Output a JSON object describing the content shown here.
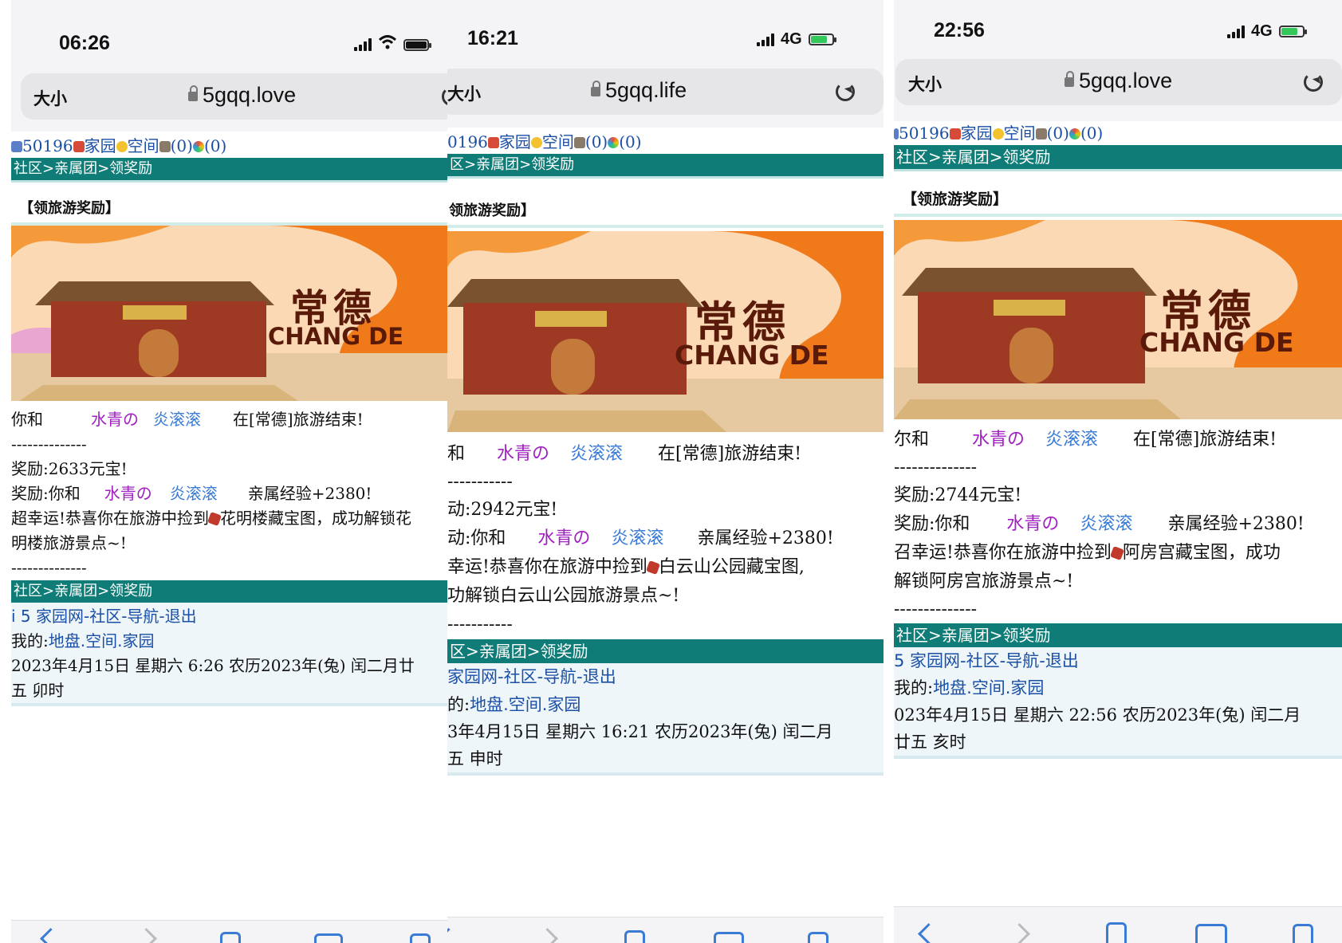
{
  "phones": [
    {
      "status": {
        "time": "06:26",
        "network": ""
      },
      "browser": {
        "text_size_label": "大小",
        "domain": "5gqq.love"
      },
      "top_line": {
        "user_id": "50196",
        "home": "家园",
        "space": "空间",
        "count1": "(0)",
        "count2": "(0)"
      },
      "breadcrumb": "社区>亲属团>领奖励",
      "heading": "【领旅游奖励】",
      "banner": {
        "city_cn": "常德",
        "city_en": "CHANG DE"
      },
      "result": {
        "you_and": "你和",
        "name1": "水青の",
        "name2": "炎滚滚",
        "end_text": "在[常德]旅游结束!"
      },
      "divider": "--------------",
      "reward_ingots": "奖励:2633元宝!",
      "reward_exp": {
        "prefix": "奖励:你和",
        "name1": "水青の",
        "name2": "炎滚滚",
        "suffix": "亲属经验+2380!"
      },
      "lucky_lines": [
        "超幸运!恭喜你在旅游中捡到",
        "花明楼藏宝图，成功解锁花",
        "明楼旅游景点~!"
      ],
      "divider2": "--------------",
      "footer": {
        "breadcrumb": "社区>亲属团>领奖励",
        "nav": "i 5 家园网-社区-导航-退出",
        "mine_label": "我的:",
        "mine_links": "地盘.空间.家园",
        "date_lines": [
          "2023年4月15日  星期六  6:26  农历2023年(兔)  闰二月廿",
          "五  卯时"
        ]
      }
    },
    {
      "status": {
        "time": "16:21",
        "network": "4G"
      },
      "browser": {
        "text_size_label": "大小",
        "domain": "5gqq.life"
      },
      "top_line": {
        "user_id": "0196",
        "home": "家园",
        "space": "空间",
        "count1": "(0)",
        "count2": "(0)"
      },
      "breadcrumb": "区>亲属团>领奖励",
      "heading": "领旅游奖励】",
      "banner": {
        "city_cn": "常德",
        "city_en": "CHANG DE"
      },
      "result": {
        "you_and": "和",
        "name1": "水青の",
        "name2": "炎滚滚",
        "end_text": "在[常德]旅游结束!"
      },
      "divider": "-----------",
      "reward_ingots": "动:2942元宝!",
      "reward_exp": {
        "prefix": "动:你和",
        "name1": "水青の",
        "name2": "炎滚滚",
        "suffix": "亲属经验+2380!"
      },
      "lucky_lines": [
        "幸运!恭喜你在旅游中捡到",
        "白云山公园藏宝图,",
        "功解锁白云山公园旅游景点~!"
      ],
      "divider2": "-----------",
      "footer": {
        "breadcrumb": "区>亲属团>领奖励",
        "nav": "家园网-社区-导航-退出",
        "mine_label": "的:",
        "mine_links": "地盘.空间.家园",
        "date_lines": [
          "3年4月15日  星期六  16:21  农历2023年(兔)  闰二月",
          "五  申时"
        ]
      }
    },
    {
      "status": {
        "time": "22:56",
        "network": "4G"
      },
      "browser": {
        "text_size_label": "大小",
        "domain": "5gqq.love"
      },
      "top_line": {
        "user_id": "50196",
        "home": "家园",
        "space": "空间",
        "count1": "(0)",
        "count2": "(0)"
      },
      "breadcrumb": "社区>亲属团>领奖励",
      "heading": "【领旅游奖励】",
      "banner": {
        "city_cn": "常德",
        "city_en": "CHANG DE"
      },
      "result": {
        "you_and": "尔和",
        "name1": "水青の",
        "name2": "炎滚滚",
        "end_text": "在[常德]旅游结束!"
      },
      "divider": "--------------",
      "reward_ingots": "奖励:2744元宝!",
      "reward_exp": {
        "prefix": "奖励:你和",
        "name1": "水青の",
        "name2": "炎滚滚",
        "suffix": "亲属经验+2380!"
      },
      "lucky_lines": [
        "召幸运!恭喜你在旅游中捡到",
        "阿房宫藏宝图，成功",
        "解锁阿房宫旅游景点~!"
      ],
      "divider2": "--------------",
      "footer": {
        "breadcrumb": "社区>亲属团>领奖励",
        "nav": "5 家园网-社区-导航-退出",
        "mine_label": "我的:",
        "mine_links": "地盘.空间.家园",
        "date_lines": [
          "023年4月15日  星期六  22:56  农历2023年(兔)  闰二月",
          "廿五  亥时"
        ]
      }
    }
  ],
  "colors": {
    "breadcrumb_bg": "#0f7c77",
    "link": "#1a4fa5",
    "name1": "#a020c0",
    "name2": "#3a7bd5",
    "banner_orange": "#f07a1a"
  }
}
